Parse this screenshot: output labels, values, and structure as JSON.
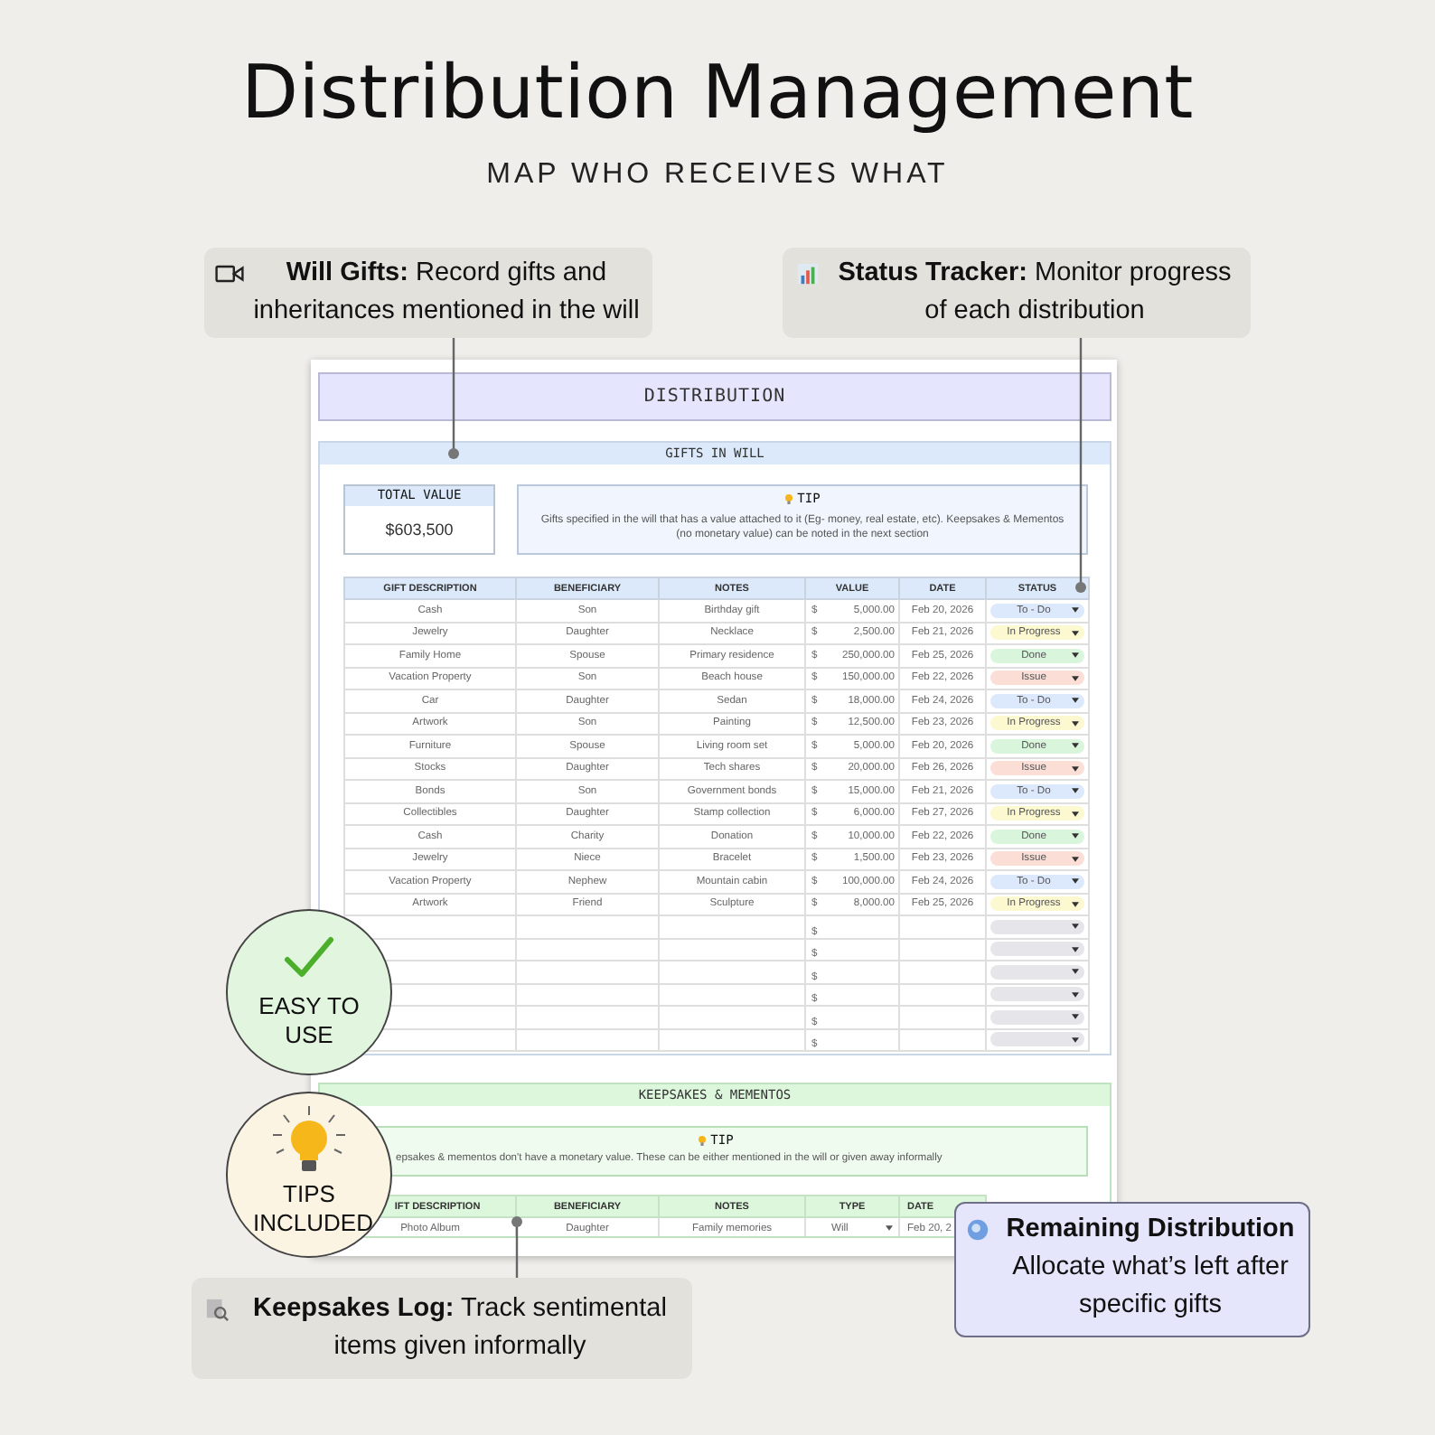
{
  "title": "Distribution Management",
  "subtitle": "MAP WHO RECEIVES WHAT",
  "callouts": [
    {
      "kind": "camera",
      "text": "**Will Gifts:** Record gifts and inheritances mentioned in the will"
    },
    {
      "kind": "chart",
      "text": "**Status Tracker:** Monitor progress of each distribution"
    },
    {
      "kind": "search",
      "text": "**Keepsakes Log:** Track sentimental items given informally"
    },
    {
      "kind": "globe",
      "text": "**Remaining Distribution** Allocate what’s left after specific gifts"
    }
  ],
  "badges": [
    {
      "kind": "check",
      "label": "EASY TO USE"
    },
    {
      "kind": "bulb",
      "label": "TIPS INCLUDED"
    }
  ],
  "sheet": {
    "title": "DISTRIBUTION",
    "gifts": {
      "header": "GIFTS IN WILL",
      "total_label": "TOTAL VALUE",
      "total_value": "$603,500",
      "tip_label": "TIP",
      "tip_text": "Gifts specified in the will that has a value attached to it (Eg- money, real estate, etc). Keepsakes & Mementos (no monetary value) can be noted in the next section",
      "columns": [
        "GIFT DESCRIPTION",
        "BENEFICIARY",
        "NOTES",
        "VALUE",
        "DATE",
        "STATUS"
      ],
      "rows": [
        {
          "description": "Cash",
          "beneficiary": "Son",
          "notes": "Birthday gift",
          "currency": "$",
          "value": "5,000.00",
          "date": "Feb 20, 2026",
          "status": {
            "label": "To - Do",
            "color": "#dce8fb"
          }
        },
        {
          "description": "Jewelry",
          "beneficiary": "Daughter",
          "notes": "Necklace",
          "currency": "$",
          "value": "2,500.00",
          "date": "Feb 21, 2026",
          "status": {
            "label": "In Progress",
            "color": "#fcf8cf"
          }
        },
        {
          "description": "Family Home",
          "beneficiary": "Spouse",
          "notes": "Primary residence",
          "currency": "$",
          "value": "250,000.00",
          "date": "Feb 25, 2026",
          "status": {
            "label": "Done",
            "color": "#d9f5dc"
          }
        },
        {
          "description": "Vacation Property",
          "beneficiary": "Son",
          "notes": "Beach house",
          "currency": "$",
          "value": "150,000.00",
          "date": "Feb 22, 2026",
          "status": {
            "label": "Issue",
            "color": "#fbdfd6"
          }
        },
        {
          "description": "Car",
          "beneficiary": "Daughter",
          "notes": "Sedan",
          "currency": "$",
          "value": "18,000.00",
          "date": "Feb 24, 2026",
          "status": {
            "label": "To - Do",
            "color": "#dce8fb"
          }
        },
        {
          "description": "Artwork",
          "beneficiary": "Son",
          "notes": "Painting",
          "currency": "$",
          "value": "12,500.00",
          "date": "Feb 23, 2026",
          "status": {
            "label": "In Progress",
            "color": "#fcf8cf"
          }
        },
        {
          "description": "Furniture",
          "beneficiary": "Spouse",
          "notes": "Living room set",
          "currency": "$",
          "value": "5,000.00",
          "date": "Feb 20, 2026",
          "status": {
            "label": "Done",
            "color": "#d9f5dc"
          }
        },
        {
          "description": "Stocks",
          "beneficiary": "Daughter",
          "notes": "Tech shares",
          "currency": "$",
          "value": "20,000.00",
          "date": "Feb 26, 2026",
          "status": {
            "label": "Issue",
            "color": "#fbdfd6"
          }
        },
        {
          "description": "Bonds",
          "beneficiary": "Son",
          "notes": "Government bonds",
          "currency": "$",
          "value": "15,000.00",
          "date": "Feb 21, 2026",
          "status": {
            "label": "To - Do",
            "color": "#dce8fb"
          }
        },
        {
          "description": "Collectibles",
          "beneficiary": "Daughter",
          "notes": "Stamp collection",
          "currency": "$",
          "value": "6,000.00",
          "date": "Feb 27, 2026",
          "status": {
            "label": "In Progress",
            "color": "#fcf8cf"
          }
        },
        {
          "description": "Cash",
          "beneficiary": "Charity",
          "notes": "Donation",
          "currency": "$",
          "value": "10,000.00",
          "date": "Feb 22, 2026",
          "status": {
            "label": "Done",
            "color": "#d9f5dc"
          }
        },
        {
          "description": "Jewelry",
          "beneficiary": "Niece",
          "notes": "Bracelet",
          "currency": "$",
          "value": "1,500.00",
          "date": "Feb 23, 2026",
          "status": {
            "label": "Issue",
            "color": "#fbdfd6"
          }
        },
        {
          "description": "Vacation Property",
          "beneficiary": "Nephew",
          "notes": "Mountain cabin",
          "currency": "$",
          "value": "100,000.00",
          "date": "Feb 24, 2026",
          "status": {
            "label": "To - Do",
            "color": "#dce8fb"
          }
        },
        {
          "description": "Artwork",
          "beneficiary": "Friend",
          "notes": "Sculpture",
          "currency": "$",
          "value": "8,000.00",
          "date": "Feb 25, 2026",
          "status": {
            "label": "In Progress",
            "color": "#fcf8cf"
          }
        },
        {
          "currency": "$",
          "status": {
            "color": "#e6e6ea"
          }
        },
        {
          "currency": "$",
          "status": {
            "color": "#e6e6ea"
          }
        },
        {
          "currency": "$",
          "status": {
            "color": "#e6e6ea"
          }
        },
        {
          "currency": "$",
          "status": {
            "color": "#e6e6ea"
          }
        },
        {
          "currency": "$",
          "status": {
            "color": "#e6e6ea"
          }
        },
        {
          "currency": "$",
          "status": {
            "color": "#e6e6ea"
          }
        }
      ]
    },
    "keepsakes": {
      "header": "KEEPSAKES & MEMENTOS",
      "tip_label": "TIP",
      "tip_text": "epsakes & mementos don't have a monetary value.  These can be either mentioned in the will or given away informally",
      "columns": [
        "IFT DESCRIPTION",
        "BENEFICIARY",
        "NOTES",
        "TYPE",
        "DATE"
      ],
      "rows": [
        {
          "description": "Photo Album",
          "beneficiary": "Daughter",
          "notes": "Family memories",
          "type": "Will",
          "date": "Feb 20, 2"
        }
      ]
    }
  }
}
